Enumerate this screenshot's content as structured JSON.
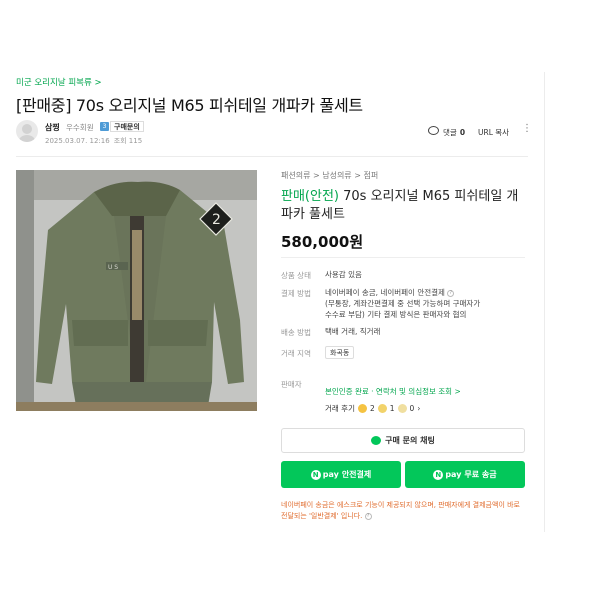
{
  "board": {
    "label": "미군 오리지날 피복류 >"
  },
  "post": {
    "title": "[판매중] 70s 오리지널 M65 피쉬테일 개파카 풀세트",
    "author": "삼찡",
    "grade": "우수회원",
    "grade_badge": "3",
    "inquiry_badge": "구매문의",
    "date": "2025.03.07. 12:16",
    "views": "조회 115",
    "comment_label": "댓글",
    "comment_count": "0",
    "url_copy": "URL 복사",
    "more": "⋮"
  },
  "product": {
    "breadcrumb": "패션의류 > 남성의류 > 점퍼",
    "title_tag": "판매(안전)",
    "title": "70s 오리지널 M65 피쉬테일 개파카 풀세트",
    "price": "580,000원",
    "condition_label": "상품 상태",
    "condition": "사용감 있음",
    "payment_label": "결제 방법",
    "payment_line1": "네이버페이 송금, 네이버페이 안전결제",
    "payment_line2": "(무통장, 계좌간편결제 중 선택 가능하며 구매자가",
    "payment_line3": "수수료 부담) 기타 결제 방식은 판매자와 협의",
    "delivery_label": "배송 방법",
    "delivery": "택배 거래, 직거래",
    "area_label": "거래 지역",
    "area": "화곡동",
    "seller_label": "판매자",
    "seller_verify": "본인인증 완료 · 연락처 및 의심정보 조회 >",
    "review_label": "거래 후기",
    "review_good": "2",
    "review_ok": "1",
    "review_bad": "0",
    "chat_button": "구매 문의 채팅",
    "pay_safe": "안전결제",
    "pay_free": "무료 송금",
    "pay_brand": "pay",
    "notice": "네이버페이 송금은 에스크로 기능이 제공되지 않으며, 판매자에게 결제금액이 바로 전달되는 '일반결제' 입니다."
  },
  "colors": {
    "brand_green": "#03c75a",
    "notice_orange": "#e06c2e"
  }
}
